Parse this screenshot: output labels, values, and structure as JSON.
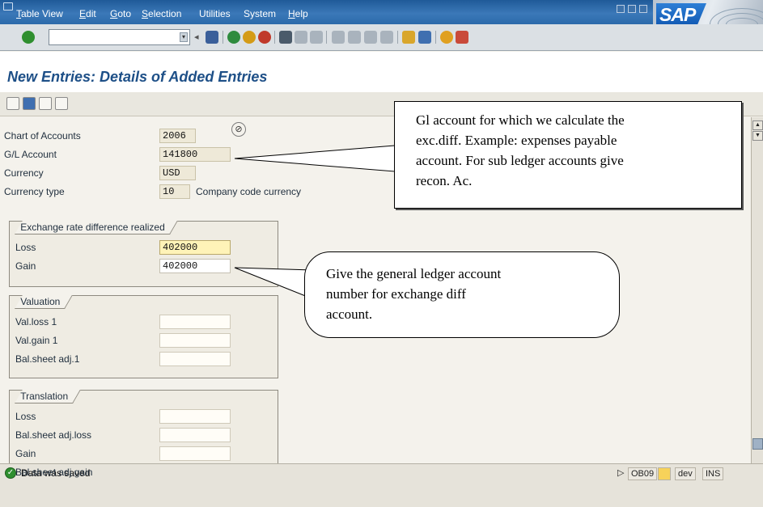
{
  "menu": {
    "items": [
      {
        "label": "Table View",
        "ul": "T",
        "rest": "able View"
      },
      {
        "label": "Edit",
        "ul": "E",
        "rest": "dit"
      },
      {
        "label": "Goto",
        "ul": "G",
        "rest": "oto"
      },
      {
        "label": "Selection",
        "ul": "S",
        "rest": "election"
      },
      {
        "label": "Utilities",
        "ul": "",
        "rest": "Utilities"
      },
      {
        "label": "System",
        "ul": "",
        "rest": "System"
      },
      {
        "label": "Help",
        "ul": "H",
        "rest": "elp"
      }
    ]
  },
  "logo": {
    "text": "SAP"
  },
  "title": "New Entries: Details of Added Entries",
  "header_fields": {
    "chart_of_accounts": {
      "label": "Chart of Accounts",
      "value": "2006"
    },
    "gl_account": {
      "label": "G/L Account",
      "value": "141800"
    },
    "currency": {
      "label": "Currency",
      "value": "USD"
    },
    "currency_type": {
      "label": "Currency type",
      "value": "10",
      "description": "Company code currency"
    }
  },
  "realized": {
    "title": "Exchange rate difference realized",
    "loss": {
      "label": "Loss",
      "value": "402000"
    },
    "gain": {
      "label": "Gain",
      "value": "402000"
    }
  },
  "valuation": {
    "title": "Valuation",
    "rows": [
      {
        "label": "Val.loss 1",
        "value": ""
      },
      {
        "label": "Val.gain 1",
        "value": ""
      },
      {
        "label": "Bal.sheet adj.1",
        "value": ""
      }
    ]
  },
  "translation": {
    "title": "Translation",
    "rows": [
      {
        "label": "Loss",
        "value": ""
      },
      {
        "label": "Bal.sheet adj.loss",
        "value": ""
      },
      {
        "label": "Gain",
        "value": ""
      },
      {
        "label": "Bal.sheet adj.gain",
        "value": ""
      }
    ]
  },
  "callouts": {
    "gl_note": [
      "Gl account for which we calculate the",
      "exc.diff. Example: expenses payable",
      "account. For sub ledger accounts give",
      "recon. Ac."
    ],
    "gain_loss_note": [
      "Give the general ledger account",
      "number for exchange diff",
      "account."
    ]
  },
  "status": {
    "message": "Data was saved",
    "transaction": "OB09",
    "system": "dev",
    "mode": "INS"
  }
}
